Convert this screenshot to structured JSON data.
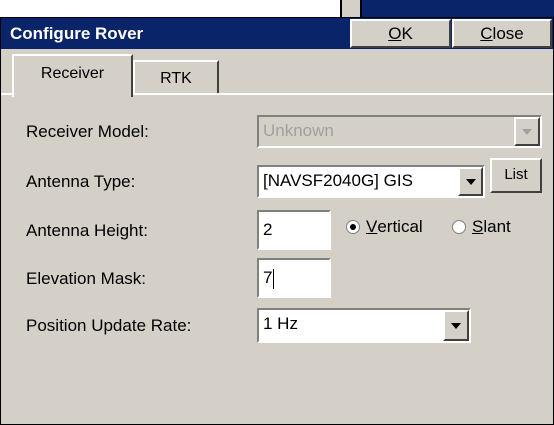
{
  "window": {
    "title": "Configure Rover",
    "ok": {
      "accel": "O",
      "rest": "K"
    },
    "close": {
      "accel": "C",
      "rest": "lose"
    }
  },
  "tabs": [
    "Receiver",
    "RTK"
  ],
  "fields": {
    "receiver_model": {
      "label": "Receiver Model:",
      "value": "Unknown"
    },
    "antenna_type": {
      "label": "Antenna Type:",
      "value": "[NAVSF2040G] GIS",
      "list_button": "List"
    },
    "antenna_height": {
      "label": "Antenna Height:",
      "value": "2",
      "vertical": {
        "accel": "V",
        "rest": "ertical",
        "checked": true
      },
      "slant": {
        "accel": "S",
        "rest": "lant",
        "checked": false
      }
    },
    "elevation_mask": {
      "label": "Elevation Mask:",
      "value": "7"
    },
    "position_update_rate": {
      "label": "Position Update Rate:",
      "value": "1 Hz"
    }
  },
  "colors": {
    "titlebar": "#0a246a",
    "face": "#d4d0c8",
    "disabled_text": "#a0a0a0"
  },
  "icons": {
    "dropdown": "chevron-down-icon"
  }
}
